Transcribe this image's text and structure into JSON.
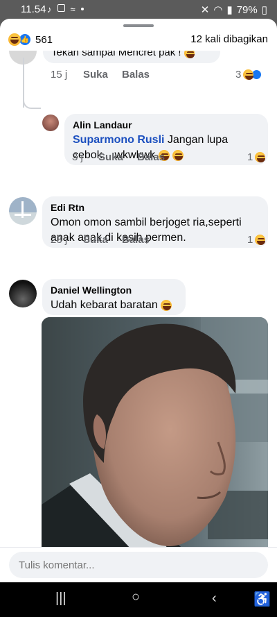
{
  "status": {
    "time": "11.54",
    "battery": "79%"
  },
  "header": {
    "reaction_count": "561",
    "share_count": "12 kali dibagikan"
  },
  "comments": [
    {
      "text": "Tekan sampai Mencret pak !",
      "time": "15 j",
      "like": "Suka",
      "reply": "Balas",
      "reactions": "3"
    },
    {
      "author": "Alin Landaur",
      "mention": "Suparmono Rusli",
      "text": "Jangan lupa cebok .. wkwkwk",
      "time": "3 j",
      "like": "Suka",
      "reply": "Balas",
      "reactions": "1"
    },
    {
      "author": "Edi Rtn",
      "text_line1": "Omon omon sambil berjoget ria,seperti",
      "text_line2": "anak anak di kasih permen.",
      "time": "23 j",
      "like": "Suka",
      "reply": "Balas",
      "reactions": "1"
    },
    {
      "author": "Daniel Wellington",
      "text": "Udah kebarat baratan"
    }
  ],
  "input": {
    "placeholder": "Tulis komentar..."
  },
  "colors": {
    "link": "#1b4fbf",
    "bubble": "#f0f2f5",
    "facebook_blue": "#1877f2"
  }
}
